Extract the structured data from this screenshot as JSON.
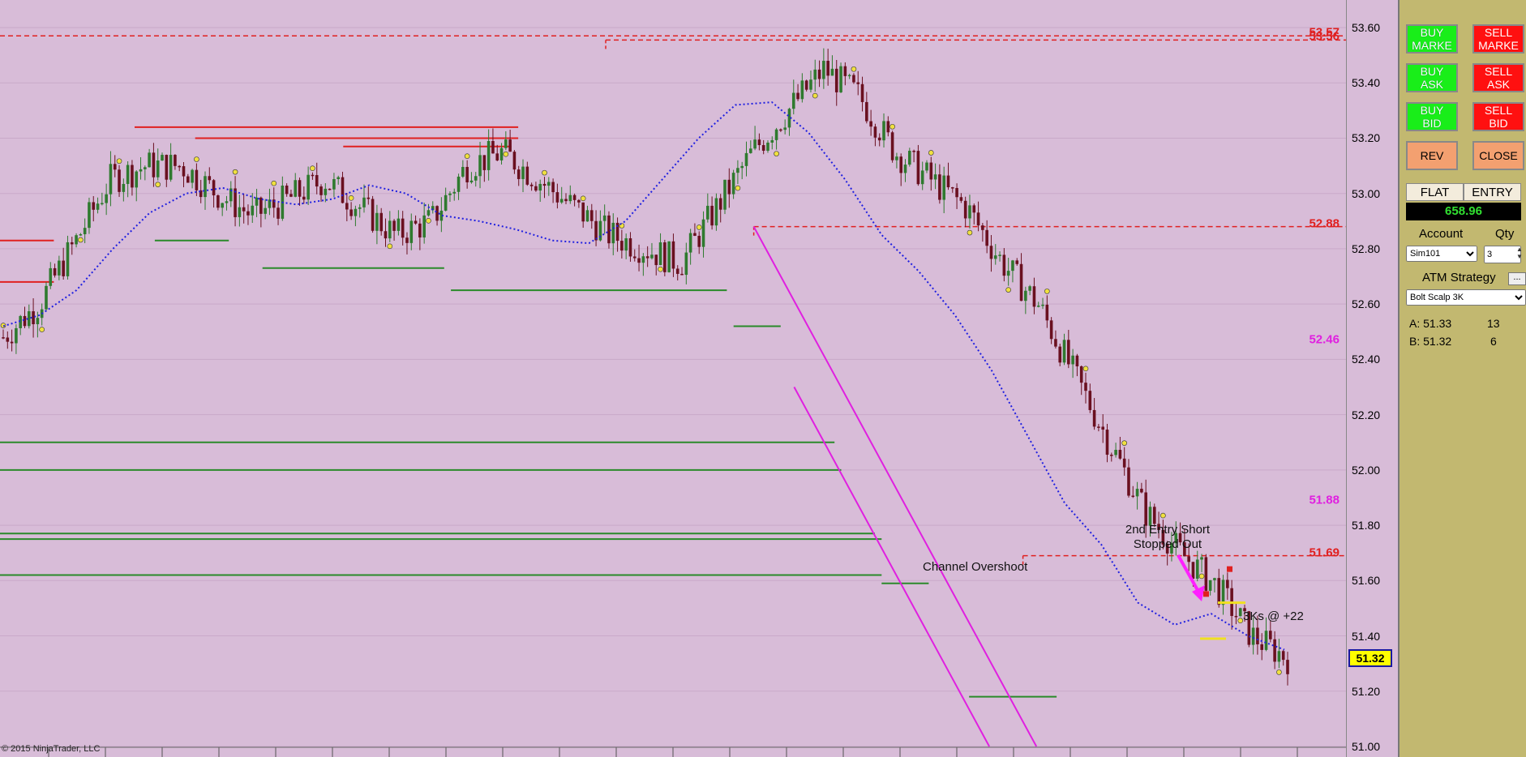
{
  "copyright": "© 2015 NinjaTrader, LLC",
  "price_axis": {
    "ticks": [
      "53.60",
      "53.40",
      "53.20",
      "53.00",
      "52.80",
      "52.60",
      "52.40",
      "52.20",
      "52.00",
      "51.80",
      "51.60",
      "51.40",
      "51.20",
      "51.00"
    ],
    "tick_values": [
      53.6,
      53.4,
      53.2,
      53.0,
      52.8,
      52.6,
      52.4,
      52.2,
      52.0,
      51.8,
      51.6,
      51.4,
      51.2,
      51.0
    ],
    "current_price": "51.32",
    "level_labels": [
      {
        "text": "53.57",
        "value": 53.57,
        "color": "#e02020"
      },
      {
        "text": "53.56",
        "value": 53.555,
        "color": "#e02020"
      },
      {
        "text": "52.88",
        "value": 52.88,
        "color": "#e02020"
      },
      {
        "text": "52.46",
        "value": 52.46,
        "color": "#e020e0"
      },
      {
        "text": "51.88",
        "value": 51.88,
        "color": "#e020e0"
      },
      {
        "text": "51.69",
        "value": 51.69,
        "color": "#e02020"
      }
    ]
  },
  "annotations": {
    "entry_short": "2nd Entry Short",
    "stopped_out": "Stopped Out",
    "channel_overshoot": "Channel Overshoot",
    "scalp_result": "3Ks @ +22"
  },
  "colors": {
    "background": "#d8bcd8",
    "bull_candle": "#2f7a2f",
    "bear_candle": "#6a1020",
    "resistance": "#e02020",
    "support": "#2a8a2a",
    "channel": "#e020e0",
    "moving_average": "#2020e0",
    "panel": "#c2b870"
  },
  "panel": {
    "buttons": [
      {
        "id": "buy-market",
        "l1": "BUY",
        "l2": "MARKE",
        "kind": "buy"
      },
      {
        "id": "sell-market",
        "l1": "SELL",
        "l2": "MARKE",
        "kind": "sell"
      },
      {
        "id": "buy-ask",
        "l1": "BUY",
        "l2": "ASK",
        "kind": "buy"
      },
      {
        "id": "sell-ask",
        "l1": "SELL",
        "l2": "ASK",
        "kind": "sell"
      },
      {
        "id": "buy-bid",
        "l1": "BUY",
        "l2": "BID",
        "kind": "buy"
      },
      {
        "id": "sell-bid",
        "l1": "SELL",
        "l2": "BID",
        "kind": "sell"
      },
      {
        "id": "rev",
        "l1": "REV",
        "l2": "",
        "kind": "orange"
      },
      {
        "id": "close",
        "l1": "CLOSE",
        "l2": "",
        "kind": "orange"
      }
    ],
    "position": "FLAT",
    "entry_label": "ENTRY",
    "pnl": "658.96",
    "account_label": "Account",
    "qty_label": "Qty",
    "account": "Sim101",
    "qty": "3",
    "atm_label": "ATM Strategy",
    "atm_more": "...",
    "atm_strategy": "Bolt Scalp 3K",
    "ask_label": "A: 51.33",
    "ask_size": "13",
    "bid_label": "B: 51.32",
    "bid_size": "6"
  },
  "chart_data": {
    "type": "candlestick",
    "y_range": [
      51.0,
      53.6
    ],
    "levels": {
      "resistance": [
        {
          "value": 53.57,
          "from": 0,
          "to": 1
        },
        {
          "value": 53.555,
          "from": 0.45,
          "to": 1
        },
        {
          "value": 52.88,
          "from": 0.56,
          "to": 1
        },
        {
          "value": 51.69,
          "from": 0.76,
          "to": 1
        }
      ],
      "support_solid": [
        {
          "value": 52.83,
          "from": 0,
          "to": 0.04
        },
        {
          "value": 52.68,
          "from": 0,
          "to": 0.04
        },
        {
          "value": 53.24,
          "from": 0.1,
          "to": 0.385
        },
        {
          "value": 53.2,
          "from": 0.145,
          "to": 0.385
        },
        {
          "value": 53.17,
          "from": 0.255,
          "to": 0.38
        }
      ],
      "support_green": [
        {
          "value": 52.83,
          "from": 0.115,
          "to": 0.17
        },
        {
          "value": 52.73,
          "from": 0.195,
          "to": 0.33
        },
        {
          "value": 52.65,
          "from": 0.335,
          "to": 0.54
        },
        {
          "value": 52.52,
          "from": 0.545,
          "to": 0.58
        },
        {
          "value": 52.1,
          "from": 0,
          "to": 0.62
        },
        {
          "value": 52.0,
          "from": 0,
          "to": 0.625
        },
        {
          "value": 51.77,
          "from": 0,
          "to": 0.65
        },
        {
          "value": 51.75,
          "from": 0,
          "to": 0.655
        },
        {
          "value": 51.62,
          "from": 0,
          "to": 0.655
        },
        {
          "value": 51.59,
          "from": 0.655,
          "to": 0.69
        },
        {
          "value": 51.18,
          "from": 0.72,
          "to": 0.785
        }
      ]
    },
    "channel": [
      {
        "x1": 0.56,
        "y1": 52.88,
        "x2": 0.77,
        "y2": 51.0
      },
      {
        "x1": 0.59,
        "y1": 52.3,
        "x2": 0.735,
        "y2": 51.0
      }
    ],
    "ma": [
      52.52,
      52.56,
      52.65,
      52.8,
      52.93,
      53.0,
      53.02,
      52.98,
      52.96,
      52.98,
      53.03,
      53.0,
      52.92,
      52.9,
      52.87,
      52.83,
      52.82,
      52.9,
      53.05,
      53.2,
      53.32,
      53.33,
      53.22,
      53.05,
      52.85,
      52.72,
      52.56,
      52.36,
      52.12,
      51.88,
      51.73,
      51.52,
      51.44,
      51.48,
      51.4,
      51.35
    ],
    "price_path": [
      52.48,
      52.6,
      52.82,
      53.05,
      53.1,
      53.1,
      53.0,
      52.92,
      52.98,
      53.05,
      52.95,
      52.85,
      52.9,
      53.1,
      53.15,
      53.05,
      52.95,
      52.85,
      52.8,
      52.75,
      52.95,
      53.15,
      53.3,
      53.45,
      53.35,
      53.15,
      53.05,
      52.95,
      52.75,
      52.6,
      52.35,
      52.1,
      51.85,
      51.7,
      51.58,
      51.4,
      51.32
    ],
    "cur_price": 51.32
  }
}
